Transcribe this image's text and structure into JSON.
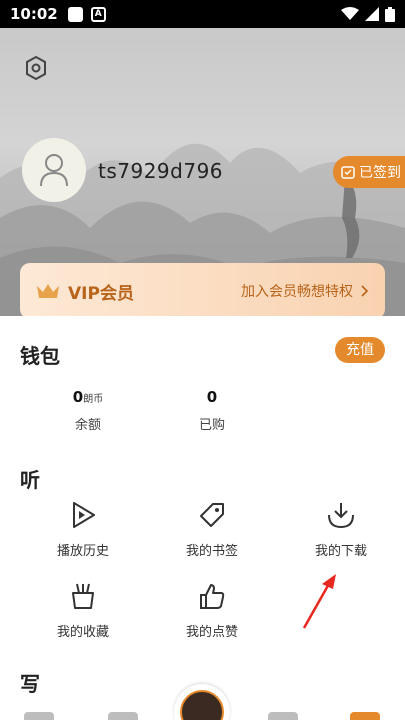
{
  "status_bar": {
    "time": "10:02"
  },
  "header": {
    "username": "ts7929d796",
    "signed_label": "已签到",
    "vip_label": "VIP会员",
    "vip_promo": "加入会员畅想特权"
  },
  "wallet": {
    "title": "钱包",
    "recharge_label": "充值",
    "balance": {
      "value": "0",
      "unit": "朗币",
      "label": "余额"
    },
    "purchased": {
      "value": "0",
      "label": "已购"
    }
  },
  "listen": {
    "title": "听",
    "items": [
      {
        "label": "播放历史",
        "icon": "play-history-icon"
      },
      {
        "label": "我的书签",
        "icon": "bookmark-tag-icon"
      },
      {
        "label": "我的下载",
        "icon": "download-icon"
      },
      {
        "label": "我的收藏",
        "icon": "collection-icon"
      },
      {
        "label": "我的点赞",
        "icon": "thumbs-up-icon"
      }
    ]
  },
  "write": {
    "title": "写"
  },
  "colors": {
    "accent": "#e58a2c",
    "vip_text": "#b8641b",
    "annotation_arrow": "#e8281e"
  }
}
